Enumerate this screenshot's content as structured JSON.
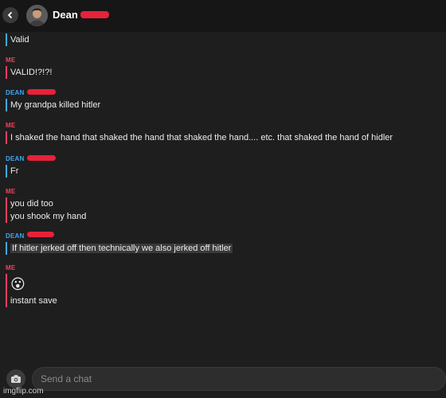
{
  "header": {
    "back_label": "<",
    "contact_name": "Dean"
  },
  "messages": [
    {
      "sender": "",
      "lines": [
        "Valid"
      ]
    },
    {
      "sender": "ME",
      "lines": [
        "VALID!?!?!"
      ]
    },
    {
      "sender": "DEAN",
      "lines": [
        "My grandpa killed hitler"
      ]
    },
    {
      "sender": "ME",
      "lines": [
        "I shaked the hand that shaked the hand that shaked the hand.... etc. that shaked the hand of hidler"
      ]
    },
    {
      "sender": "DEAN",
      "lines": [
        "Fr"
      ]
    },
    {
      "sender": "ME",
      "lines": [
        "you did too",
        "you shook my hand"
      ]
    },
    {
      "sender": "DEAN",
      "lines": [
        "If hitler jerked off then technically we also jerked off hitler"
      ]
    },
    {
      "sender": "ME",
      "emoji": "😮",
      "lines": [
        "instant save"
      ]
    }
  ],
  "composer": {
    "placeholder": "Send a chat"
  },
  "watermark": "imgflip.com",
  "colors": {
    "me": "#f2415c",
    "dean": "#3ea8f5",
    "background": "#1e1e1e"
  },
  "icons": [
    "back-arrow-icon",
    "avatar-icon",
    "camera-icon",
    "astonished-face-emoji"
  ]
}
